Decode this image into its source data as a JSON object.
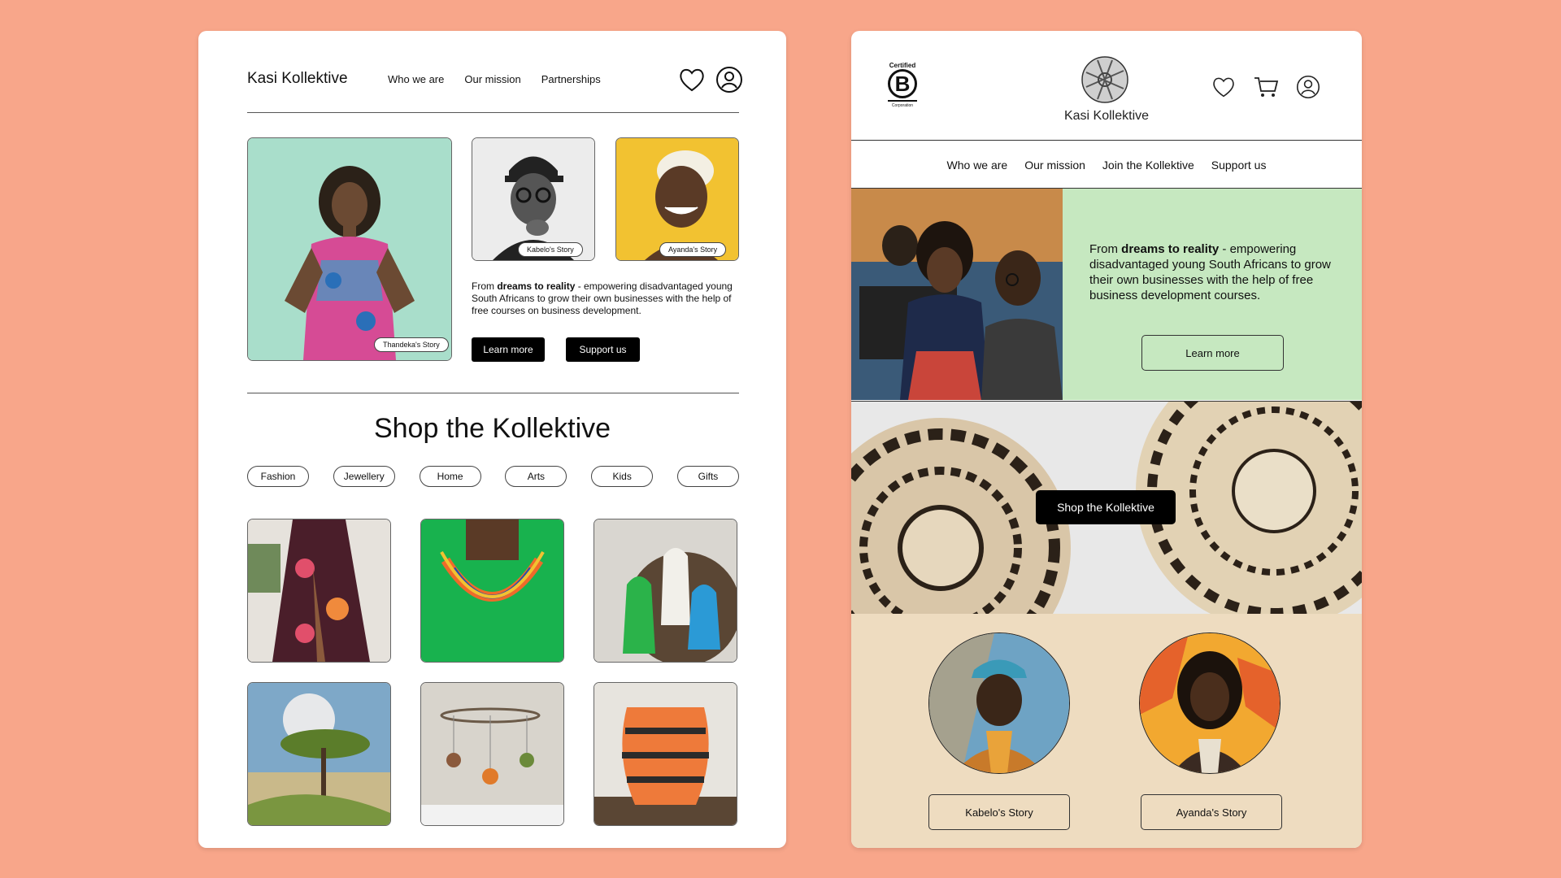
{
  "left": {
    "brand": "Kasi Kollektive",
    "nav": [
      "Who we are",
      "Our mission",
      "Partnerships"
    ],
    "stories": {
      "main": "Thandeka's Story",
      "second": "Kabelo's Story",
      "third": "Ayanda's Story"
    },
    "blurb_pre": "From ",
    "blurb_bold": "dreams to reality",
    "blurb_post": " - empowering disadvantaged young South Africans to grow their own businesses with the help of free courses on business development.",
    "learn_more": "Learn more",
    "support_us": "Support us",
    "shop_title": "Shop the Kollektive",
    "categories": [
      "Fashion",
      "Jewellery",
      "Home",
      "Arts",
      "Kids",
      "Gifts"
    ]
  },
  "right": {
    "bcorp_top": "Certified",
    "bcorp_letter": "B",
    "bcorp_bottom": "Corporation",
    "brand": "Kasi Kollektive",
    "nav": [
      "Who we are",
      "Our mission",
      "Join the Kollektive",
      "Support us"
    ],
    "hero_pre": "From ",
    "hero_bold": "dreams to reality",
    "hero_post": " - empowering disadvantaged young South Africans to grow their own businesses with the help of free business development courses.",
    "learn_more": "Learn more",
    "shop_button": "Shop the Kollektive",
    "story1": "Kabelo's Story",
    "story2": "Ayanda's Story"
  },
  "colors": {
    "background": "#F8A68A",
    "hero_green": "#C6E8C0",
    "stories_beige": "#EEDCC0"
  }
}
